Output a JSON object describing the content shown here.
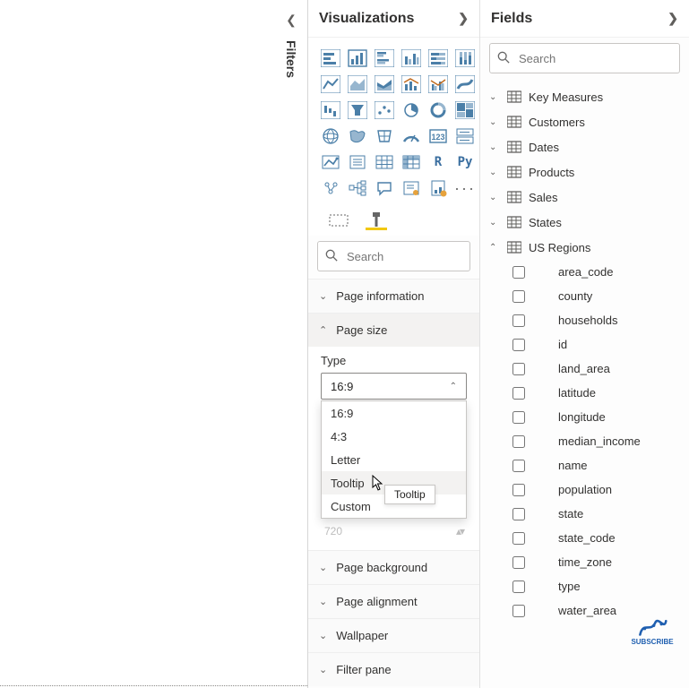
{
  "filters_rail": {
    "label": "Filters"
  },
  "visualizations": {
    "title": "Visualizations",
    "search_placeholder": "Search",
    "sections": {
      "page_info": "Page information",
      "page_size": "Page size",
      "page_bg": "Page background",
      "page_align": "Page alignment",
      "wallpaper": "Wallpaper",
      "filter_pane": "Filter pane"
    },
    "page_size": {
      "type_label": "Type",
      "selected": "16:9",
      "options": [
        "16:9",
        "4:3",
        "Letter",
        "Tooltip",
        "Custom"
      ],
      "hover_option": "Tooltip",
      "tooltip_text": "Tooltip",
      "ghost_left": "720"
    }
  },
  "fields": {
    "title": "Fields",
    "search_placeholder": "Search",
    "tables": [
      {
        "name": "Key Measures",
        "expanded": false
      },
      {
        "name": "Customers",
        "expanded": false
      },
      {
        "name": "Dates",
        "expanded": false
      },
      {
        "name": "Products",
        "expanded": false
      },
      {
        "name": "Sales",
        "expanded": false
      },
      {
        "name": "States",
        "expanded": false
      },
      {
        "name": "US Regions",
        "expanded": true,
        "fields": [
          "area_code",
          "county",
          "households",
          "id",
          "land_area",
          "latitude",
          "longitude",
          "median_income",
          "name",
          "population",
          "state",
          "state_code",
          "time_zone",
          "type",
          "water_area"
        ]
      }
    ],
    "subscribe": "SUBSCRIBE"
  }
}
